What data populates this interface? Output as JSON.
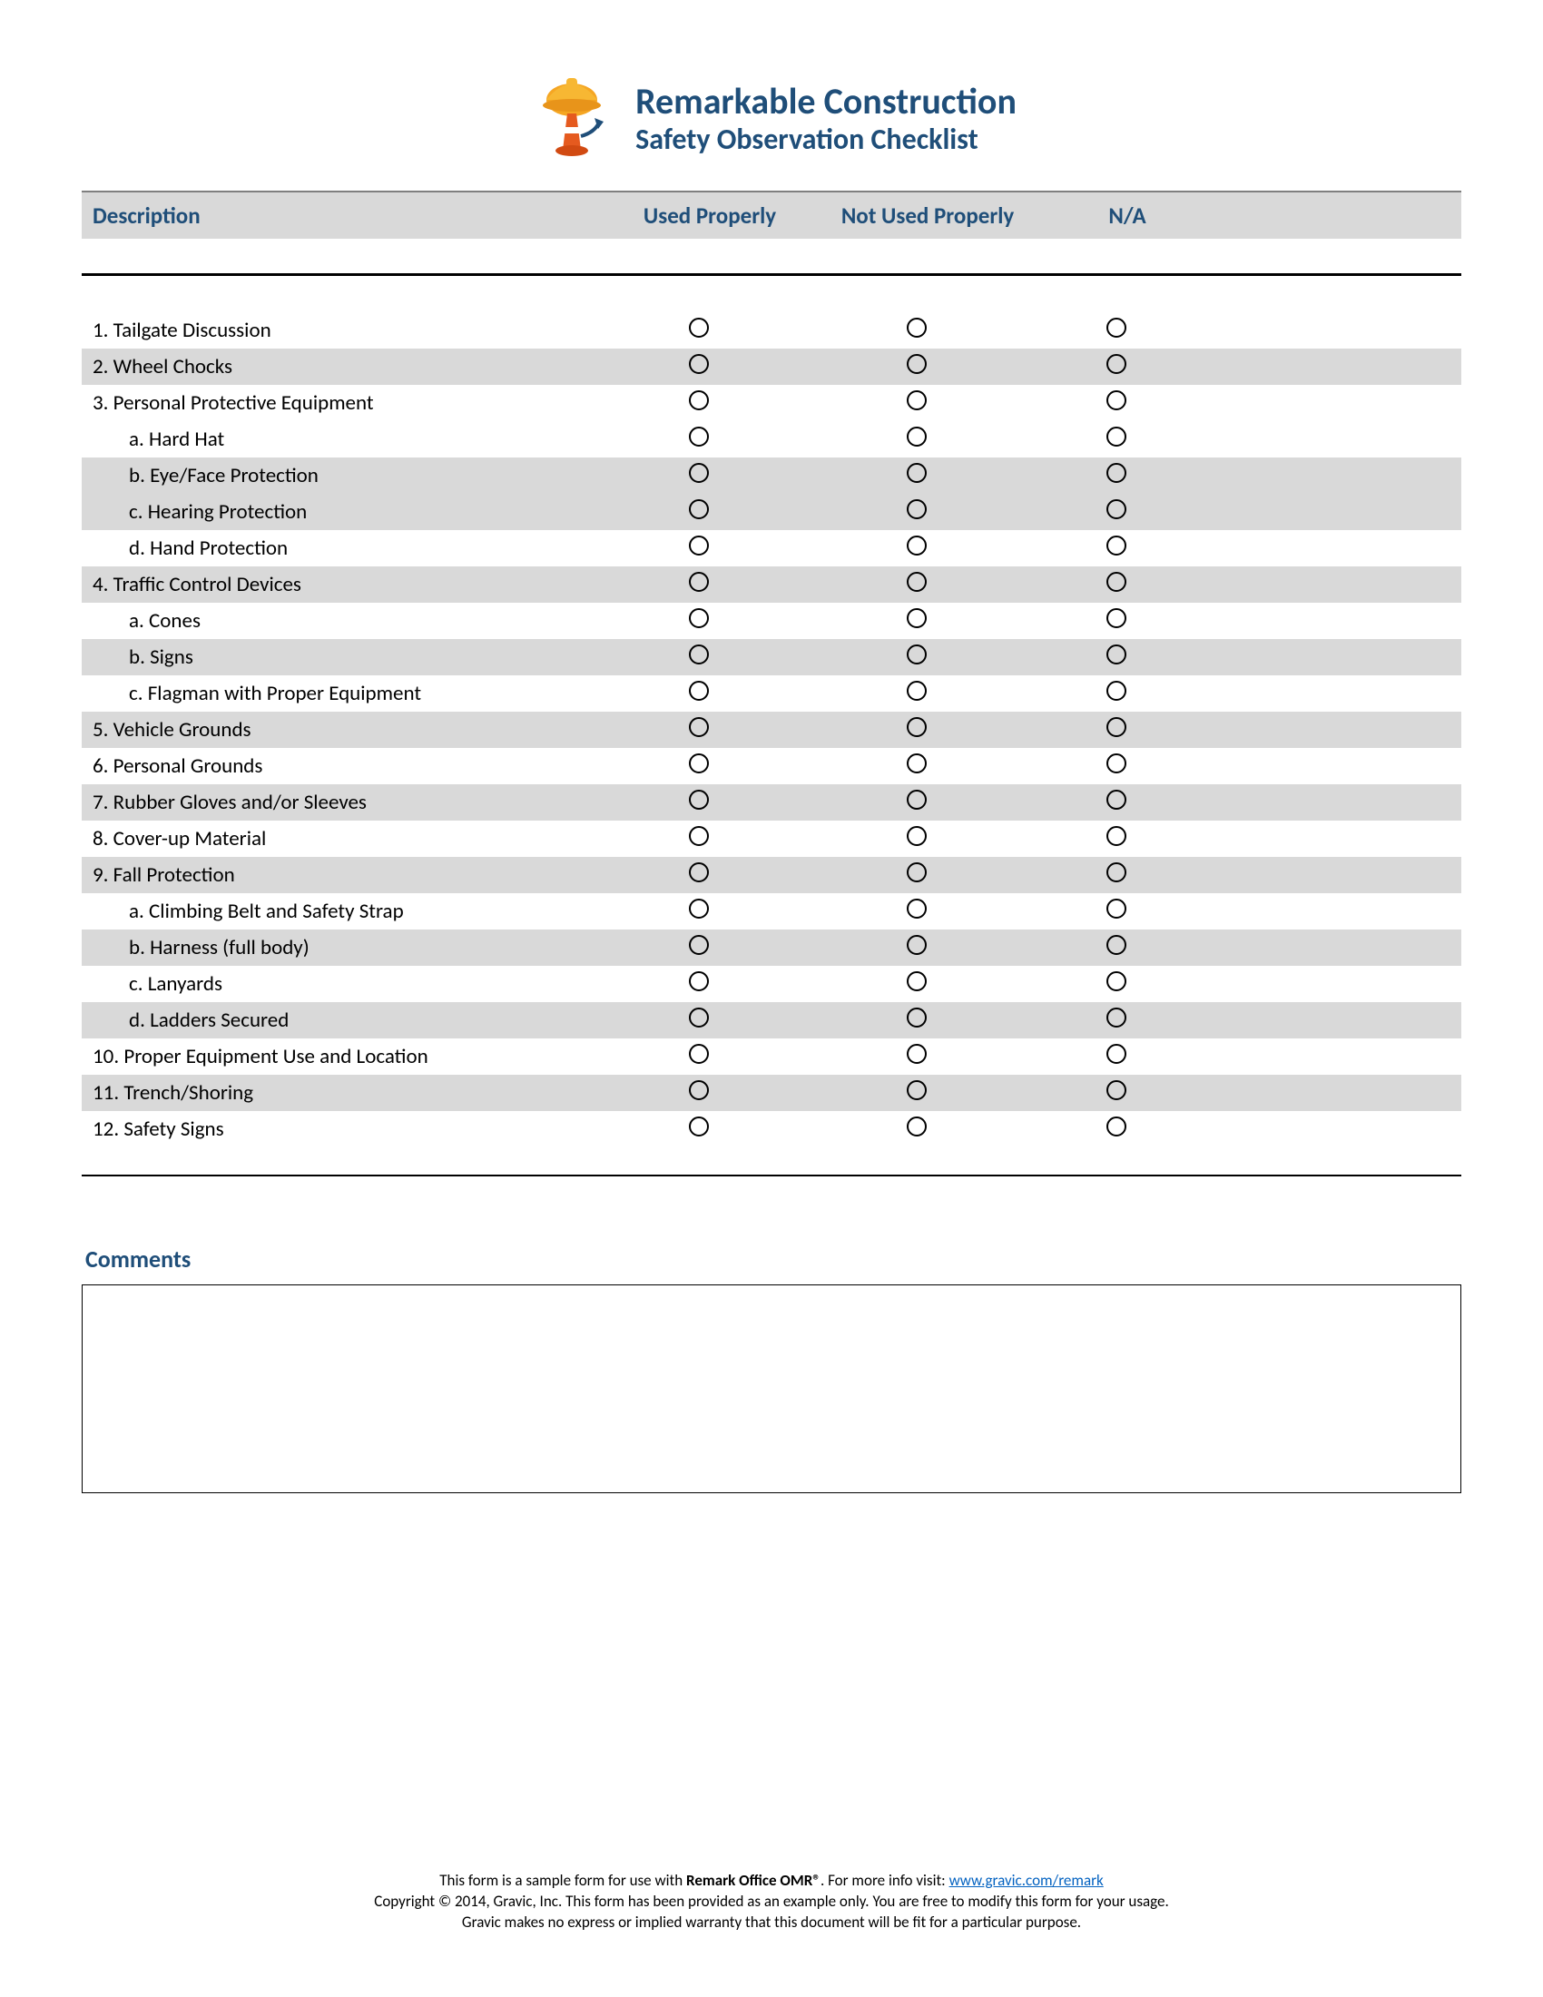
{
  "header": {
    "title": "Remarkable Construction",
    "subtitle": "Safety Observation Checklist"
  },
  "columns": {
    "description": "Description",
    "used": "Used Properly",
    "notused": "Not Used Properly",
    "na": "N/A"
  },
  "rows": [
    {
      "label": "1. Tailgate Discussion",
      "indent": false,
      "shade": false
    },
    {
      "label": "2. Wheel Chocks",
      "indent": false,
      "shade": true
    },
    {
      "label": "3. Personal Protective Equipment",
      "indent": false,
      "shade": false
    },
    {
      "label": "a. Hard Hat",
      "indent": true,
      "shade": false
    },
    {
      "label": "b. Eye/Face Protection",
      "indent": true,
      "shade": true
    },
    {
      "label": "c. Hearing Protection",
      "indent": true,
      "shade": true
    },
    {
      "label": "d. Hand Protection",
      "indent": true,
      "shade": false
    },
    {
      "label": "4. Traffic Control Devices",
      "indent": false,
      "shade": true
    },
    {
      "label": "a. Cones",
      "indent": true,
      "shade": false
    },
    {
      "label": "b. Signs",
      "indent": true,
      "shade": true
    },
    {
      "label": "c. Flagman with Proper Equipment",
      "indent": true,
      "shade": false
    },
    {
      "label": "5. Vehicle Grounds",
      "indent": false,
      "shade": true
    },
    {
      "label": "6. Personal Grounds",
      "indent": false,
      "shade": false
    },
    {
      "label": "7. Rubber Gloves and/or Sleeves",
      "indent": false,
      "shade": true
    },
    {
      "label": "8. Cover-up Material",
      "indent": false,
      "shade": false
    },
    {
      "label": "9. Fall Protection",
      "indent": false,
      "shade": true
    },
    {
      "label": "a. Climbing Belt and Safety Strap",
      "indent": true,
      "shade": false
    },
    {
      "label": "b. Harness (full body)",
      "indent": true,
      "shade": true
    },
    {
      "label": "c. Lanyards",
      "indent": true,
      "shade": false
    },
    {
      "label": "d. Ladders Secured",
      "indent": true,
      "shade": true
    },
    {
      "label": "10. Proper Equipment Use and Location",
      "indent": false,
      "shade": false
    },
    {
      "label": "11. Trench/Shoring",
      "indent": false,
      "shade": true
    },
    {
      "label": "12. Safety Signs",
      "indent": false,
      "shade": false
    }
  ],
  "comments_label": "Comments",
  "footer": {
    "line1_pre": "This form is a sample form for use with ",
    "line1_bold": "Remark Office OMR®",
    "line1_post": ". For more info visit: ",
    "link_text": "www.gravic.com/remark",
    "line2": "Copyright © 2014, Gravic, Inc. This form has been provided as an example only. You are free to modify this form for your usage.",
    "line3": "Gravic makes no express or implied warranty that this document will be fit for a particular purpose."
  }
}
